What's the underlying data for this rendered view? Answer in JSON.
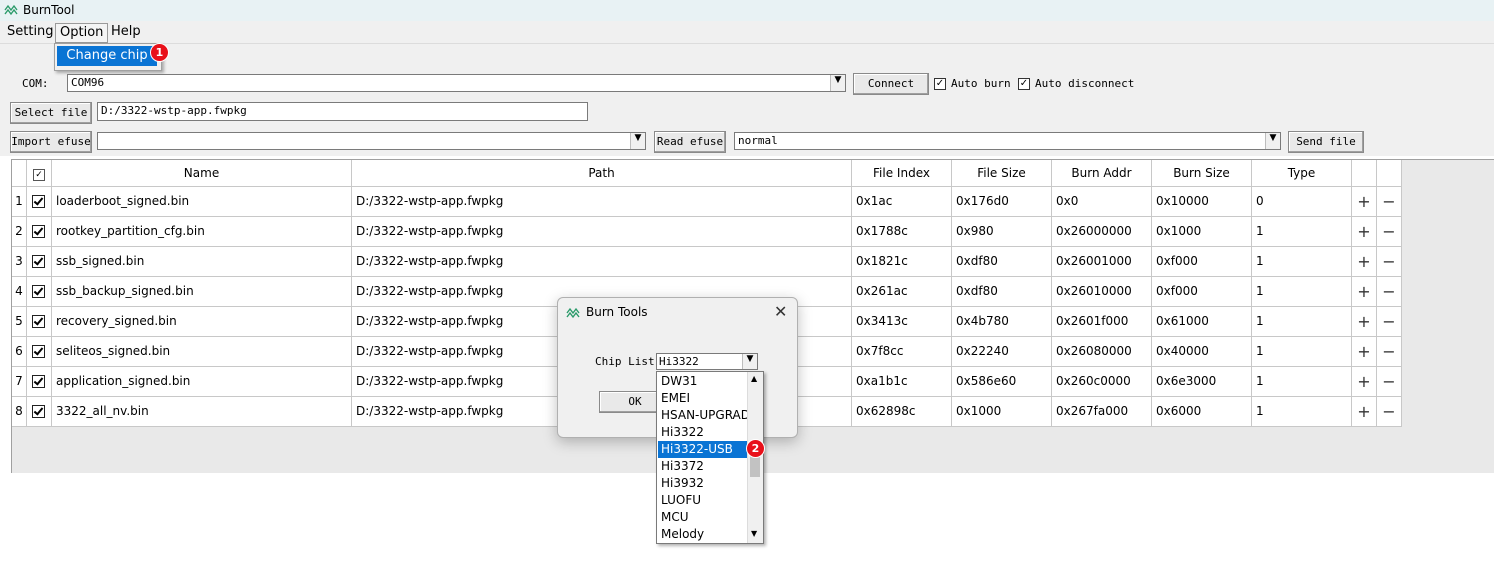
{
  "window": {
    "title": "BurnTool"
  },
  "menu": {
    "setting": "Setting",
    "option": "Option",
    "help": "Help",
    "change_chip": "Change chip",
    "badge_1": "1"
  },
  "toolbar": {
    "com_label": "COM:",
    "com_value": "COM96",
    "connect": "Connect",
    "auto_burn": "Auto burn",
    "auto_disconnect": "Auto disconnect",
    "select_file": "Select file",
    "file_path": "D:/3322-wstp-app.fwpkg",
    "import_efuse": "Import efuse",
    "efuse_value": "",
    "read_efuse": "Read efuse",
    "mode_value": "normal",
    "send_file": "Send file"
  },
  "table": {
    "headers": {
      "name": "Name",
      "path": "Path",
      "index": "File Index",
      "size": "File Size",
      "addr": "Burn Addr",
      "bsize": "Burn Size",
      "type": "Type"
    },
    "plus": "+",
    "minus": "−",
    "rows": [
      {
        "num": "1",
        "name": "loaderboot_signed.bin",
        "path": "D:/3322-wstp-app.fwpkg",
        "index": "0x1ac",
        "size": "0x176d0",
        "addr": "0x0",
        "bsize": "0x10000",
        "type": "0"
      },
      {
        "num": "2",
        "name": "rootkey_partition_cfg.bin",
        "path": "D:/3322-wstp-app.fwpkg",
        "index": "0x1788c",
        "size": "0x980",
        "addr": "0x26000000",
        "bsize": "0x1000",
        "type": "1"
      },
      {
        "num": "3",
        "name": "ssb_signed.bin",
        "path": "D:/3322-wstp-app.fwpkg",
        "index": "0x1821c",
        "size": "0xdf80",
        "addr": "0x26001000",
        "bsize": "0xf000",
        "type": "1"
      },
      {
        "num": "4",
        "name": "ssb_backup_signed.bin",
        "path": "D:/3322-wstp-app.fwpkg",
        "index": "0x261ac",
        "size": "0xdf80",
        "addr": "0x26010000",
        "bsize": "0xf000",
        "type": "1"
      },
      {
        "num": "5",
        "name": "recovery_signed.bin",
        "path": "D:/3322-wstp-app.fwpkg",
        "index": "0x3413c",
        "size": "0x4b780",
        "addr": "0x2601f000",
        "bsize": "0x61000",
        "type": "1"
      },
      {
        "num": "6",
        "name": "seliteos_signed.bin",
        "path": "D:/3322-wstp-app.fwpkg",
        "index": "0x7f8cc",
        "size": "0x22240",
        "addr": "0x26080000",
        "bsize": "0x40000",
        "type": "1"
      },
      {
        "num": "7",
        "name": "application_signed.bin",
        "path": "D:/3322-wstp-app.fwpkg",
        "index": "0xa1b1c",
        "size": "0x586e60",
        "addr": "0x260c0000",
        "bsize": "0x6e3000",
        "type": "1"
      },
      {
        "num": "8",
        "name": "3322_all_nv.bin",
        "path": "D:/3322-wstp-app.fwpkg",
        "index": "0x62898c",
        "size": "0x1000",
        "addr": "0x267fa000",
        "bsize": "0x6000",
        "type": "1"
      }
    ]
  },
  "dialog": {
    "title": "Burn Tools",
    "chip_label": "Chip List",
    "chip_value": "Hi3322",
    "ok": "OK",
    "badge_2": "2",
    "options": [
      "DW31",
      "EMEI",
      "HSAN-UPGRADE",
      "Hi3322",
      "Hi3322-USB",
      "Hi3372",
      "Hi3932",
      "LUOFU",
      "MCU",
      "Melody"
    ],
    "selected_index": 4
  },
  "colors": {
    "selection": "#0a74d4",
    "badge": "#e8101a",
    "title_bg": "#e8f2f4"
  }
}
